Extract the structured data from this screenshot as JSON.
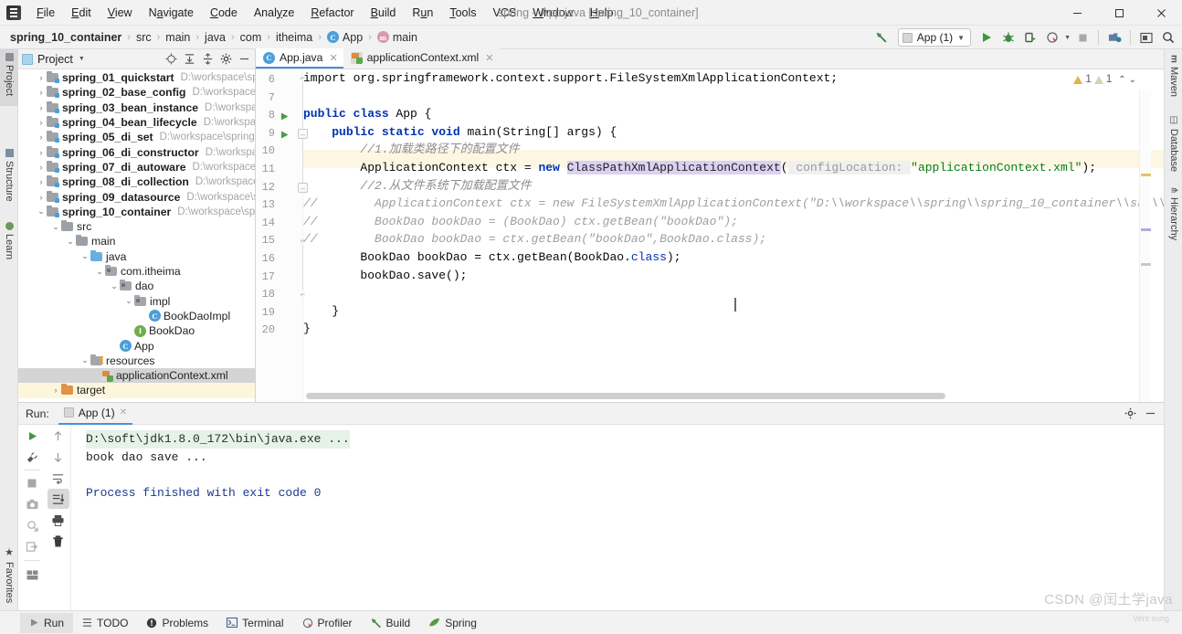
{
  "window": {
    "title": "spring – App.java [spring_10_container]",
    "controls": {
      "minimize": "—",
      "maximize": "❐",
      "close": "✕"
    }
  },
  "menubar": {
    "items": [
      {
        "label": "File",
        "mnemonic": "F"
      },
      {
        "label": "Edit",
        "mnemonic": "E"
      },
      {
        "label": "View",
        "mnemonic": "V"
      },
      {
        "label": "Navigate",
        "mnemonic": "N"
      },
      {
        "label": "Code",
        "mnemonic": "C"
      },
      {
        "label": "Analyze",
        "mnemonic": "y"
      },
      {
        "label": "Refactor",
        "mnemonic": "R"
      },
      {
        "label": "Build",
        "mnemonic": "B"
      },
      {
        "label": "Run",
        "mnemonic": "u"
      },
      {
        "label": "Tools",
        "mnemonic": "T"
      },
      {
        "label": "VCS",
        "mnemonic": ""
      },
      {
        "label": "Window",
        "mnemonic": "W"
      },
      {
        "label": "Help",
        "mnemonic": "H"
      }
    ]
  },
  "breadcrumb": {
    "items": [
      {
        "label": "spring_10_container",
        "bold": true,
        "icon": ""
      },
      {
        "label": "src",
        "bold": false,
        "icon": ""
      },
      {
        "label": "main",
        "bold": false,
        "icon": ""
      },
      {
        "label": "java",
        "bold": false,
        "icon": ""
      },
      {
        "label": "com",
        "bold": false,
        "icon": ""
      },
      {
        "label": "itheima",
        "bold": false,
        "icon": ""
      },
      {
        "label": "App",
        "bold": false,
        "icon": "class-icon"
      },
      {
        "label": "main",
        "bold": false,
        "icon": "method-icon"
      }
    ],
    "separator": "›"
  },
  "toolbar": {
    "build_label": "build-hammer-icon",
    "run_config": "App (1)",
    "run_label": "run-icon",
    "debug_label": "debug-icon",
    "coverage_label": "run-with-coverage-icon",
    "profiler_label": "profiler-icon",
    "stop_label": "stop-icon",
    "updates_label": "update-project-icon",
    "layout_label": "layout-icon",
    "search_label": "search-icon"
  },
  "left_tool_window_bar": {
    "items": [
      {
        "label": "Project",
        "icon": "project-icon",
        "selected": true
      },
      {
        "label": "Structure",
        "icon": "structure-icon",
        "selected": false
      },
      {
        "label": "Learn",
        "icon": "learn-icon",
        "selected": false
      },
      {
        "label": "Favorites",
        "icon": "star-icon",
        "selected": false
      }
    ]
  },
  "right_tool_window_bar": {
    "items": [
      {
        "label": "Maven",
        "icon": "maven-icon"
      },
      {
        "label": "Database",
        "icon": "database-icon"
      },
      {
        "label": "Hierarchy",
        "icon": "hierarchy-icon"
      }
    ]
  },
  "project_panel": {
    "title": "Project",
    "dropdown_icon": "chevron-down-icon",
    "actions": [
      {
        "name": "locate-icon"
      },
      {
        "name": "expand-all-icon"
      },
      {
        "name": "collapse-all-icon"
      },
      {
        "name": "settings-gear-icon"
      },
      {
        "name": "hide-icon"
      }
    ],
    "tree": [
      {
        "arrow": "›",
        "label": "spring_01_quickstart",
        "bold": true,
        "path": "D:\\workspace\\spring",
        "icon": "module-folder",
        "indent": 0,
        "state": ""
      },
      {
        "arrow": "›",
        "label": "spring_02_base_config",
        "bold": true,
        "path": "D:\\workspace\\sprin",
        "icon": "module-folder",
        "indent": 0,
        "state": ""
      },
      {
        "arrow": "›",
        "label": "spring_03_bean_instance",
        "bold": true,
        "path": "D:\\workspace\\sp",
        "icon": "module-folder",
        "indent": 0,
        "state": ""
      },
      {
        "arrow": "›",
        "label": "spring_04_bean_lifecycle",
        "bold": true,
        "path": "D:\\workspace\\spi",
        "icon": "module-folder",
        "indent": 0,
        "state": ""
      },
      {
        "arrow": "›",
        "label": "spring_05_di_set",
        "bold": true,
        "path": "D:\\workspace\\spring\\spri",
        "icon": "module-folder",
        "indent": 0,
        "state": ""
      },
      {
        "arrow": "›",
        "label": "spring_06_di_constructor",
        "bold": true,
        "path": "D:\\workspace\\sp",
        "icon": "module-folder",
        "indent": 0,
        "state": ""
      },
      {
        "arrow": "›",
        "label": "spring_07_di_autoware",
        "bold": true,
        "path": "D:\\workspace\\sprin",
        "icon": "module-folder",
        "indent": 0,
        "state": ""
      },
      {
        "arrow": "›",
        "label": "spring_08_di_collection",
        "bold": true,
        "path": "D:\\workspace\\spri",
        "icon": "module-folder",
        "indent": 0,
        "state": ""
      },
      {
        "arrow": "›",
        "label": "spring_09_datasource",
        "bold": true,
        "path": "D:\\workspace\\spring",
        "icon": "module-folder",
        "indent": 0,
        "state": ""
      },
      {
        "arrow": "⌄",
        "label": "spring_10_container",
        "bold": true,
        "path": "D:\\workspace\\spring\\",
        "icon": "module-folder",
        "indent": 0,
        "state": "expanded"
      },
      {
        "arrow": "⌄",
        "label": "src",
        "bold": false,
        "path": "",
        "icon": "folder",
        "indent": 1,
        "state": "expanded"
      },
      {
        "arrow": "⌄",
        "label": "main",
        "bold": false,
        "path": "",
        "icon": "folder",
        "indent": 2,
        "state": "expanded"
      },
      {
        "arrow": "⌄",
        "label": "java",
        "bold": false,
        "path": "",
        "icon": "source-folder",
        "indent": 3,
        "state": "expanded"
      },
      {
        "arrow": "⌄",
        "label": "com.itheima",
        "bold": false,
        "path": "",
        "icon": "package",
        "indent": 4,
        "state": "expanded"
      },
      {
        "arrow": "⌄",
        "label": "dao",
        "bold": false,
        "path": "",
        "icon": "package",
        "indent": 5,
        "state": "expanded"
      },
      {
        "arrow": "⌄",
        "label": "impl",
        "bold": false,
        "path": "",
        "icon": "package",
        "indent": 6,
        "state": "expanded"
      },
      {
        "arrow": "",
        "label": "BookDaoImpl",
        "bold": false,
        "path": "",
        "icon": "class",
        "indent": 7,
        "state": ""
      },
      {
        "arrow": "",
        "label": "BookDao",
        "bold": false,
        "path": "",
        "icon": "interface",
        "indent": 6,
        "state": ""
      },
      {
        "arrow": "",
        "label": "App",
        "bold": false,
        "path": "",
        "icon": "class-runnable",
        "indent": 5,
        "state": ""
      },
      {
        "arrow": "⌄",
        "label": "resources",
        "bold": false,
        "path": "",
        "icon": "resource-folder",
        "indent": 3,
        "state": "expanded"
      },
      {
        "arrow": "",
        "label": "applicationContext.xml",
        "bold": false,
        "path": "",
        "icon": "xml",
        "indent": 4,
        "state": "selected"
      },
      {
        "arrow": "›",
        "label": "target",
        "bold": false,
        "path": "",
        "icon": "target-folder",
        "indent": 1,
        "state": "highlighted"
      }
    ]
  },
  "editor": {
    "tabs": [
      {
        "label": "App.java",
        "icon": "java-class-icon",
        "active": true,
        "close": "✕"
      },
      {
        "label": "applicationContext.xml",
        "icon": "xml-file-icon",
        "active": false,
        "close": "✕"
      }
    ],
    "inspections": {
      "warning_count": "1",
      "weak_warning_count": "1",
      "prev_icon": "chevron-up-icon",
      "next_icon": "chevron-down-icon"
    },
    "first_line_number": 6,
    "lines": [
      {
        "n": 6,
        "runmark": false,
        "fold": "minus-top",
        "highlight": false
      },
      {
        "n": 7,
        "runmark": false,
        "fold": "",
        "highlight": false
      },
      {
        "n": 8,
        "runmark": true,
        "fold": "",
        "highlight": false
      },
      {
        "n": 9,
        "runmark": true,
        "fold": "minus-box",
        "highlight": false
      },
      {
        "n": 10,
        "runmark": false,
        "fold": "",
        "highlight": false
      },
      {
        "n": 11,
        "runmark": false,
        "fold": "",
        "highlight": true
      },
      {
        "n": 12,
        "runmark": false,
        "fold": "minus-box",
        "highlight": false
      },
      {
        "n": 13,
        "runmark": false,
        "fold": "",
        "highlight": false
      },
      {
        "n": 14,
        "runmark": false,
        "fold": "",
        "highlight": false
      },
      {
        "n": 15,
        "runmark": false,
        "fold": "minus-top",
        "highlight": false
      },
      {
        "n": 16,
        "runmark": false,
        "fold": "",
        "highlight": false
      },
      {
        "n": 17,
        "runmark": false,
        "fold": "",
        "highlight": false
      },
      {
        "n": 18,
        "runmark": false,
        "fold": "minus-top",
        "highlight": false
      },
      {
        "n": 19,
        "runmark": false,
        "fold": "",
        "highlight": false
      },
      {
        "n": 20,
        "runmark": false,
        "fold": "",
        "highlight": false
      }
    ],
    "code_text": [
      "import org.springframework.context.support.FileSystemXmlApplicationContext;",
      "",
      "public class App {",
      "    public static void main(String[] args) {",
      "        //1.加载类路径下的配置文件",
      "        ApplicationContext ctx = new ClassPathXmlApplicationContext( configLocation: \"applicationContext.xml\");",
      "        //2.从文件系统下加载配置文件",
      "//        ApplicationContext ctx = new FileSystemXmlApplicationContext(\"D:\\\\workspace\\\\spring\\\\spring_10_container\\\\src\\\\main\\\\",
      "//        BookDao bookDao = (BookDao) ctx.getBean(\"bookDao\");",
      "//        BookDao bookDao = ctx.getBean(\"bookDao\",BookDao.class);",
      "        BookDao bookDao = ctx.getBean(BookDao.class);",
      "        bookDao.save();",
      "",
      "    }",
      "}"
    ],
    "hint_parameter_name": "configLocation:"
  },
  "run_panel": {
    "label": "Run:",
    "tab": {
      "label": "App (1)",
      "icon": "run-config-icon",
      "close": "✕"
    },
    "head_actions": [
      {
        "name": "settings-gear-icon"
      },
      {
        "name": "hide-icon"
      }
    ],
    "toolbar_left": [
      {
        "name": "rerun-icon"
      },
      {
        "name": "edit-configurations-wrench-icon"
      },
      {
        "name": "stop-icon"
      },
      {
        "name": "screenshot-camera-icon"
      },
      {
        "name": "dump-threads-icon"
      },
      {
        "name": "export-icon"
      },
      {
        "name": "layout-icon"
      }
    ],
    "toolbar_right": [
      {
        "name": "up-arrow-icon",
        "active": false
      },
      {
        "name": "down-arrow-icon",
        "active": false
      },
      {
        "name": "soft-wrap-icon",
        "active": false
      },
      {
        "name": "scroll-to-end-icon",
        "active": true
      },
      {
        "name": "print-icon",
        "active": false
      },
      {
        "name": "clear-all-trash-icon",
        "active": false
      }
    ],
    "console": [
      {
        "text": "D:\\soft\\jdk1.8.0_172\\bin\\java.exe ...",
        "style": "command"
      },
      {
        "text": "book dao save ...",
        "style": "output"
      },
      {
        "text": "",
        "style": "output"
      },
      {
        "text": "Process finished with exit code 0",
        "style": "finished"
      }
    ]
  },
  "statusbar": {
    "items": [
      {
        "label": "Run",
        "icon": "run-icon",
        "selected": true
      },
      {
        "label": "TODO",
        "icon": "todo-icon",
        "selected": false
      },
      {
        "label": "Problems",
        "icon": "problems-icon",
        "selected": false
      },
      {
        "label": "Terminal",
        "icon": "terminal-icon",
        "selected": false
      },
      {
        "label": "Profiler",
        "icon": "profiler-icon",
        "selected": false
      },
      {
        "label": "Build",
        "icon": "build-icon",
        "selected": false
      },
      {
        "label": "Spring",
        "icon": "spring-leaf-icon",
        "selected": false
      }
    ]
  },
  "watermark": {
    "text": "CSDN @闰土学java",
    "sub": "Vent sung"
  },
  "colors": {
    "accent": "#4a90d9",
    "keyword": "#0033b3",
    "string": "#067d17",
    "comment": "#8c8c8c",
    "highlight_line": "#fdf6e3",
    "warning": "#e3b341",
    "run_green": "#4a9a4a"
  }
}
